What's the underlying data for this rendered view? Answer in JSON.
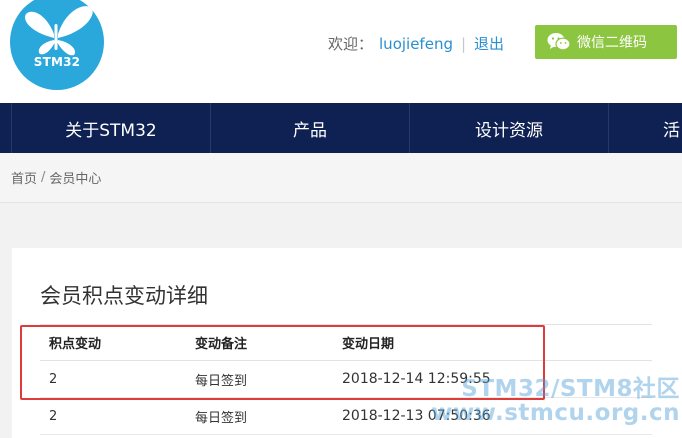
{
  "header": {
    "logo_text": "STM32",
    "welcome_label": "欢迎：",
    "username": "luojiefeng",
    "separator": "|",
    "logout_label": "退出",
    "wechat_button_label": "微信二维码"
  },
  "nav": {
    "items": [
      {
        "label": "关于STM32"
      },
      {
        "label": "产品"
      },
      {
        "label": "设计资源"
      },
      {
        "label": "活"
      }
    ]
  },
  "breadcrumb": {
    "home": "首页",
    "separator": "/",
    "current": "会员中心"
  },
  "main": {
    "title": "会员积点变动详细",
    "table": {
      "headers": [
        "积点变动",
        "变动备注",
        "变动日期"
      ],
      "rows": [
        [
          "2",
          "每日签到",
          "2018-12-14 12:59:55"
        ],
        [
          "2",
          "每日签到",
          "2018-12-13 07:50:36"
        ]
      ]
    }
  },
  "watermark": {
    "line1": "STM32/STM8社区",
    "line2": "www.stmcu.org.cn"
  },
  "colors": {
    "nav_bg": "#0f2153",
    "logo_bg": "#2aa8dc",
    "wechat_bg": "#8cc641",
    "link": "#2a8fd0",
    "highlight_border": "#e03b3b"
  },
  "icons": {
    "logo": "butterfly-icon",
    "wechat": "wechat-icon"
  }
}
